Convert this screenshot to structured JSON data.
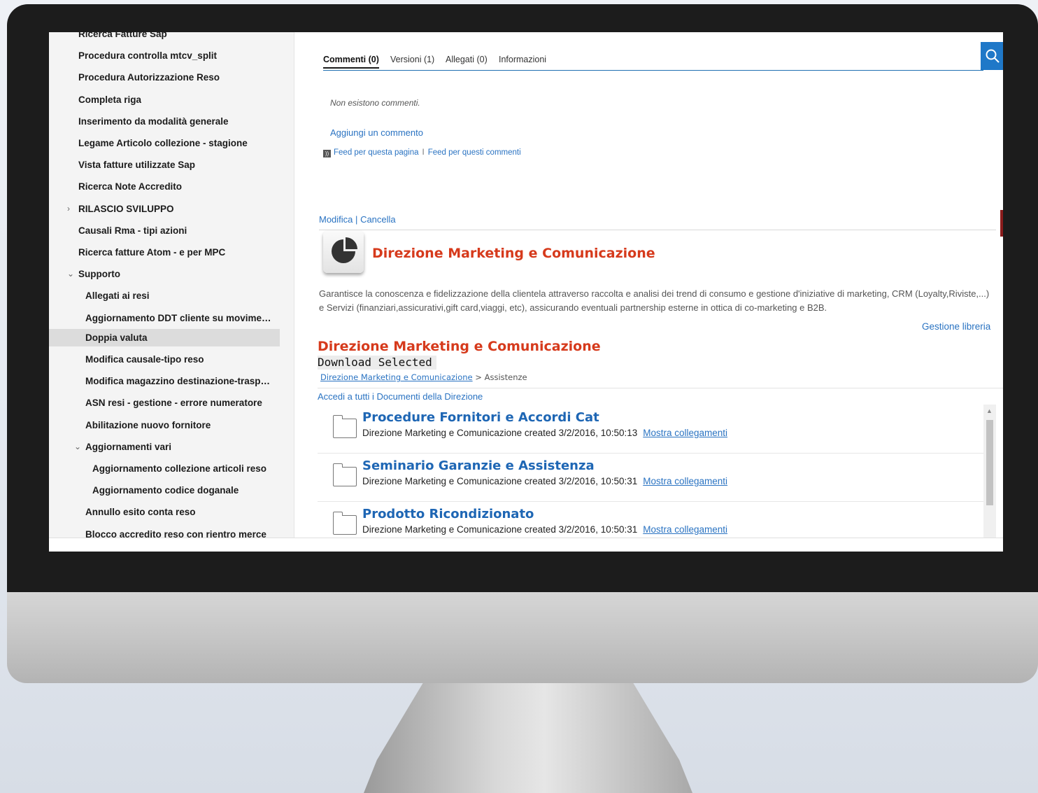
{
  "sidebar": {
    "items": [
      {
        "label": "Ricerca Fatture Sap",
        "indent": 0,
        "toggle": ""
      },
      {
        "label": "Procedura controlla mtcv_split",
        "indent": 0,
        "toggle": ""
      },
      {
        "label": "Procedura Autorizzazione Reso",
        "indent": 0,
        "toggle": ""
      },
      {
        "label": "Completa riga",
        "indent": 0,
        "toggle": ""
      },
      {
        "label": "Inserimento da modalità generale",
        "indent": 0,
        "toggle": ""
      },
      {
        "label": "Legame Articolo collezione - stagione",
        "indent": 0,
        "toggle": ""
      },
      {
        "label": "Vista fatture utilizzate Sap",
        "indent": 0,
        "toggle": ""
      },
      {
        "label": "Ricerca Note Accredito",
        "indent": 0,
        "toggle": ""
      },
      {
        "label": "RILASCIO SVILUPPO",
        "indent": 0,
        "toggle": "›"
      },
      {
        "label": "Causali Rma - tipi azioni",
        "indent": 0,
        "toggle": ""
      },
      {
        "label": "Ricerca fatture Atom - e per MPC",
        "indent": 0,
        "toggle": ""
      },
      {
        "label": "Supporto",
        "indent": 0,
        "toggle": "⌄"
      },
      {
        "label": "Allegati ai resi",
        "indent": 1,
        "toggle": ""
      },
      {
        "label": "Aggiornamento DDT cliente su movimenti",
        "indent": 1,
        "toggle": ""
      },
      {
        "label": "Doppia valuta",
        "indent": 1,
        "toggle": "",
        "selected": true
      },
      {
        "label": "Modifica causale-tipo reso",
        "indent": 1,
        "toggle": ""
      },
      {
        "label": "Modifica magazzino destinazione-trasporto",
        "indent": 1,
        "toggle": ""
      },
      {
        "label": "ASN resi - gestione - errore numeratore",
        "indent": 1,
        "toggle": ""
      },
      {
        "label": "Abilitazione nuovo fornitore",
        "indent": 1,
        "toggle": ""
      },
      {
        "label": "Aggiornamenti vari",
        "indent": 1,
        "toggle": "⌄"
      },
      {
        "label": "Aggiornamento collezione articoli reso",
        "indent": 2,
        "toggle": ""
      },
      {
        "label": "Aggiornamento codice doganale",
        "indent": 2,
        "toggle": ""
      },
      {
        "label": "Annullo esito conta reso",
        "indent": 1,
        "toggle": ""
      },
      {
        "label": "Blocco accredito reso con rientro merce",
        "indent": 1,
        "toggle": ""
      }
    ]
  },
  "tabs": {
    "comments": "Commenti (0)",
    "versions": "Versioni (1)",
    "attachments": "Allegati (0)",
    "info": "Informazioni"
  },
  "search_icon": "search-icon",
  "comments": {
    "empty_text": "Non esistono commenti.",
    "add_link": "Aggiungi un commento",
    "feed_page": "Feed per questa pagina",
    "feed_separator": "I",
    "feed_comments": "Feed per questi commenti"
  },
  "actions": {
    "edit": "Modifica",
    "separator": "|",
    "delete": "Cancella"
  },
  "page": {
    "title": "Direzione Marketing e Comunicazione",
    "description": "Garantisce la conoscenza e fidelizzazione della clientela attraverso raccolta e analisi dei trend di consumo e gestione d'iniziative di marketing, CRM (Loyalty,Riviste,...) e Servizi (finanziari,assicurativi,gift card,viaggi, etc), assicurando eventuali partnership esterne in ottica di co-marketing e B2B.",
    "manage_library": "Gestione libreria"
  },
  "library": {
    "title": "Direzione Marketing e Comunicazione",
    "download_button": "Download Selected",
    "breadcrumb_root": "Direzione Marketing e Comunicazione",
    "breadcrumb_sep": ">",
    "breadcrumb_current": "Assistenze",
    "access_link": "Accedi a tutti i Documenti della Direzione",
    "documents": [
      {
        "title": "Procedure Fornitori e Accordi Cat",
        "meta": "Direzione Marketing e Comunicazione created 3/2/2016, 10:50:13",
        "link": "Mostra collegamenti"
      },
      {
        "title": "Seminario Garanzie e Assistenza",
        "meta": "Direzione Marketing e Comunicazione created 3/2/2016, 10:50:31",
        "link": "Mostra collegamenti"
      },
      {
        "title": "Prodotto Ricondizionato",
        "meta": "Direzione Marketing e Comunicazione created 3/2/2016, 10:50:31",
        "link": "Mostra collegamenti"
      }
    ]
  },
  "colors": {
    "accent_blue": "#2a73c2",
    "title_red": "#d63a1c",
    "search_blue": "#1f78c8"
  }
}
